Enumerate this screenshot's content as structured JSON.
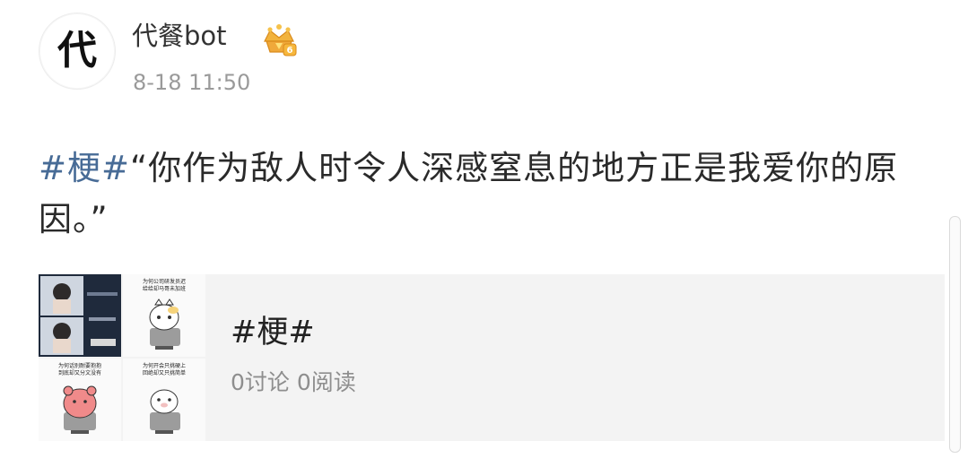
{
  "post": {
    "avatar_char": "代",
    "username": "代餐bot",
    "vip_badge_icon": "vip-crown-icon",
    "timestamp": "8-18 11:50",
    "hashtag": "#梗#",
    "text": "“你作为敌人时令人深感窒息的地方正是我爱你的原因。”"
  },
  "topic_card": {
    "title": "#梗#",
    "meta": "0讨论 0阅读",
    "thumbnails": [
      {
        "name": "photo-collage"
      },
      {
        "name": "sticker-cat-chair",
        "caption_line1": "为何公司研发员迟",
        "caption_line2": "给给却马哥未加班"
      },
      {
        "name": "sticker-pink-bear",
        "caption_line1": "为何话别耐要抱抱",
        "caption_line2": "到底却又分文没有"
      },
      {
        "name": "sticker-white-cat",
        "caption_line1": "为何开会只挑硬上",
        "caption_line2": "回绝却又只挑简单"
      }
    ]
  },
  "colors": {
    "hashtag": "#476b96",
    "text": "#2a2a2a",
    "meta": "#8e8e8e",
    "card_bg": "#f3f3f3"
  }
}
